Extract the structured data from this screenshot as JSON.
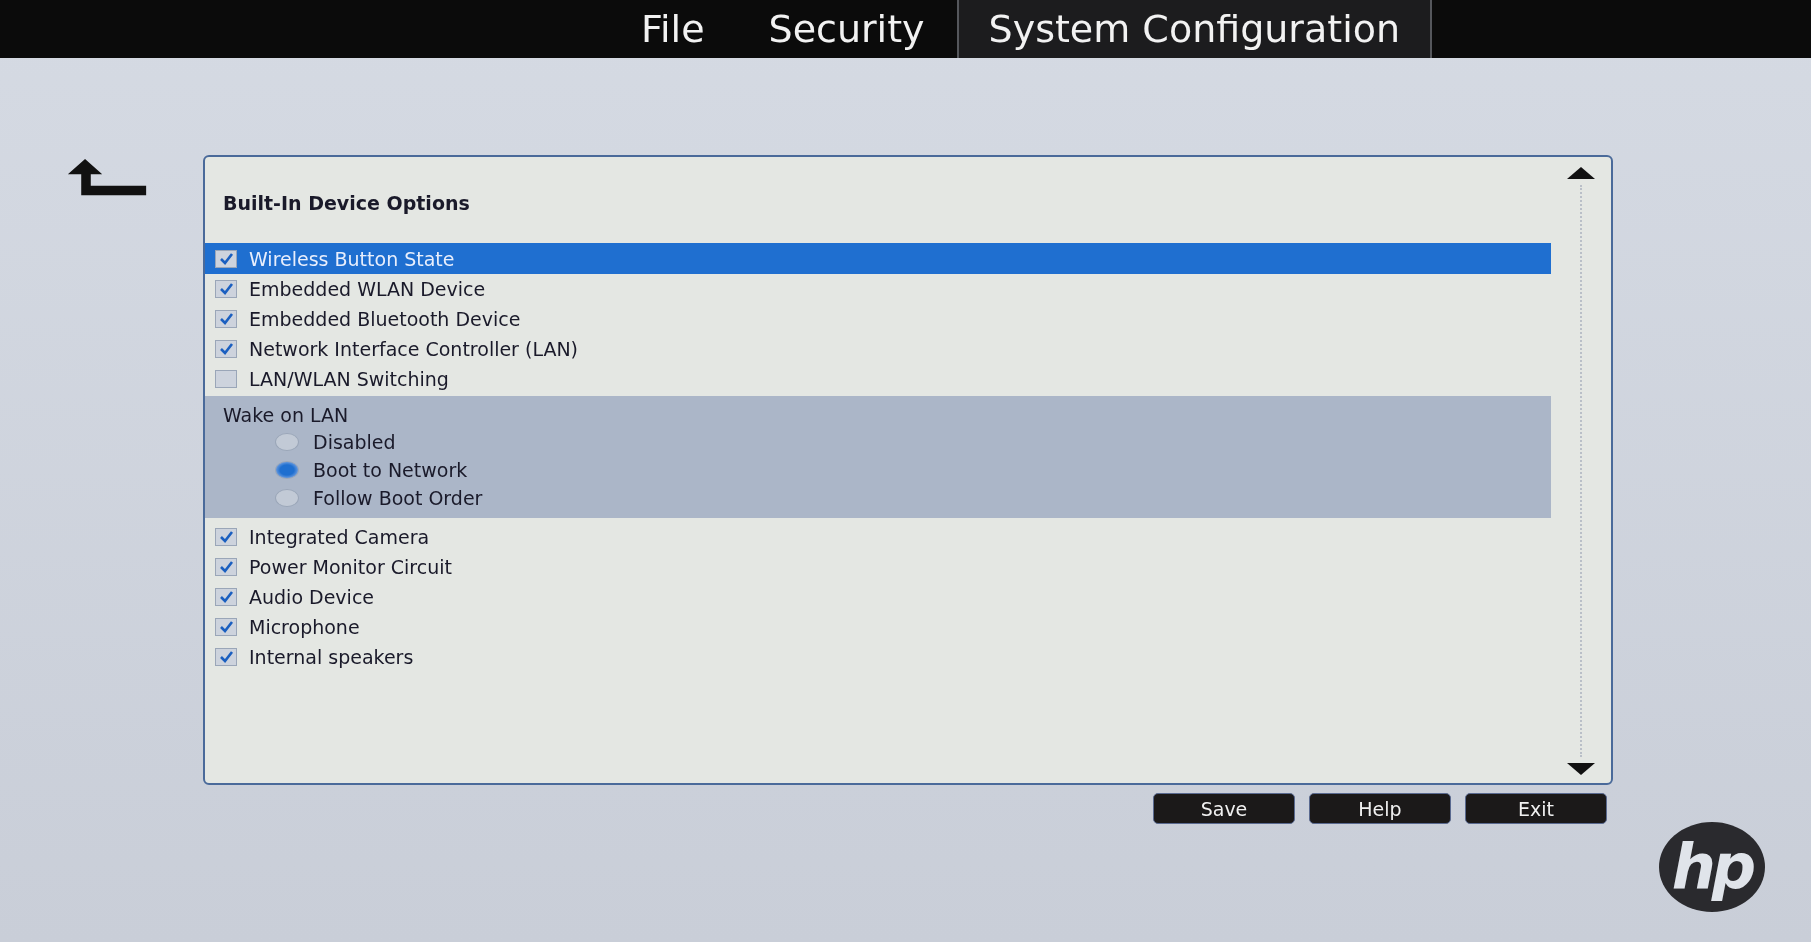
{
  "tabs": [
    {
      "label": "File",
      "selected": false
    },
    {
      "label": "Security",
      "selected": false
    },
    {
      "label": "System Configuration",
      "selected": true
    }
  ],
  "panel": {
    "title": "Built-In Device Options",
    "items": [
      {
        "kind": "checkbox",
        "label": "Wireless Button State",
        "checked": true,
        "selected": true
      },
      {
        "kind": "checkbox",
        "label": "Embedded WLAN Device",
        "checked": true,
        "selected": false
      },
      {
        "kind": "checkbox",
        "label": "Embedded Bluetooth Device",
        "checked": true,
        "selected": false
      },
      {
        "kind": "checkbox",
        "label": "Network Interface Controller (LAN)",
        "checked": true,
        "selected": false
      },
      {
        "kind": "checkbox",
        "label": "LAN/WLAN Switching",
        "checked": false,
        "selected": false
      },
      {
        "kind": "radio-group",
        "label": "Wake on LAN",
        "selected": false,
        "options": [
          {
            "label": "Disabled",
            "selected": false
          },
          {
            "label": "Boot to Network",
            "selected": true
          },
          {
            "label": "Follow Boot Order",
            "selected": false
          }
        ]
      },
      {
        "kind": "checkbox",
        "label": "Integrated Camera",
        "checked": true,
        "selected": false
      },
      {
        "kind": "checkbox",
        "label": "Power Monitor Circuit",
        "checked": true,
        "selected": false
      },
      {
        "kind": "checkbox",
        "label": "Audio Device",
        "checked": true,
        "selected": false
      },
      {
        "kind": "checkbox",
        "label": "Microphone",
        "checked": true,
        "selected": false
      },
      {
        "kind": "checkbox",
        "label": "Internal speakers",
        "checked": true,
        "selected": false
      }
    ]
  },
  "buttons": [
    "Save",
    "Help",
    "Exit"
  ],
  "logo": {
    "text": "hp"
  }
}
